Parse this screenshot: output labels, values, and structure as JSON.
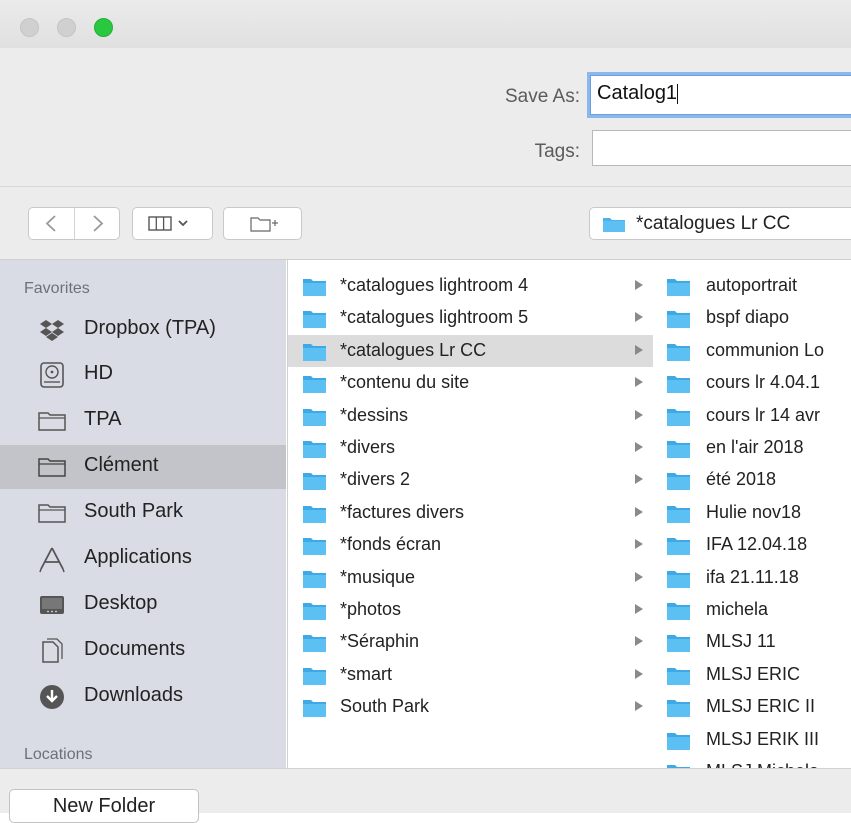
{
  "window": {
    "traffic_lights": [
      "close",
      "minimize",
      "zoom"
    ],
    "accent_green": "#2ac840"
  },
  "form": {
    "save_as_label": "Save As:",
    "save_as_value": "Catalog1",
    "tags_label": "Tags:",
    "tags_value": ""
  },
  "toolbar": {
    "back_icon": "chevron-left-icon",
    "forward_icon": "chevron-right-icon",
    "view_icon": "column-view-icon",
    "new_folder_icon": "new-folder-icon",
    "location": "*catalogues Lr CC"
  },
  "sidebar": {
    "favorites_header": "Favorites",
    "locations_header": "Locations",
    "items": [
      {
        "label": "Dropbox (TPA)",
        "icon": "dropbox-icon"
      },
      {
        "label": "HD",
        "icon": "hard-drive-icon"
      },
      {
        "label": "TPA",
        "icon": "folder-icon"
      },
      {
        "label": "Clément",
        "icon": "folder-icon",
        "selected": true
      },
      {
        "label": "South Park",
        "icon": "folder-icon"
      },
      {
        "label": "Applications",
        "icon": "applications-icon"
      },
      {
        "label": "Desktop",
        "icon": "desktop-icon"
      },
      {
        "label": "Documents",
        "icon": "documents-icon"
      },
      {
        "label": "Downloads",
        "icon": "downloads-icon"
      }
    ]
  },
  "column1": [
    "*catalogues lightroom 4",
    "*catalogues lightroom 5",
    "*catalogues Lr CC",
    "*contenu du site",
    "*dessins",
    "*divers",
    "*divers 2",
    "*factures divers",
    "*fonds écran",
    "*musique",
    "*photos",
    "*Séraphin",
    "*smart",
    "South Park"
  ],
  "column1_selected": "*catalogues Lr CC",
  "column2": [
    "autoportrait",
    "bspf diapo",
    "communion Lo",
    "cours lr 4.04.1",
    "cours lr 14 avr",
    "en l'air 2018",
    "été 2018",
    "Hulie nov18",
    "IFA 12.04.18",
    "ifa 21.11.18",
    "michela",
    "MLSJ 11",
    "MLSJ ERIC",
    "MLSJ ERIC II",
    "MLSJ ERIK III",
    "MLSJ Michela"
  ],
  "bottom": {
    "new_folder_label": "New Folder"
  },
  "colors": {
    "folder_blue": "#4ab3ec",
    "sidebar_bg": "#dadce5",
    "selection_gray": "#c3c4c9",
    "focus_ring": "#8ab7ee"
  }
}
